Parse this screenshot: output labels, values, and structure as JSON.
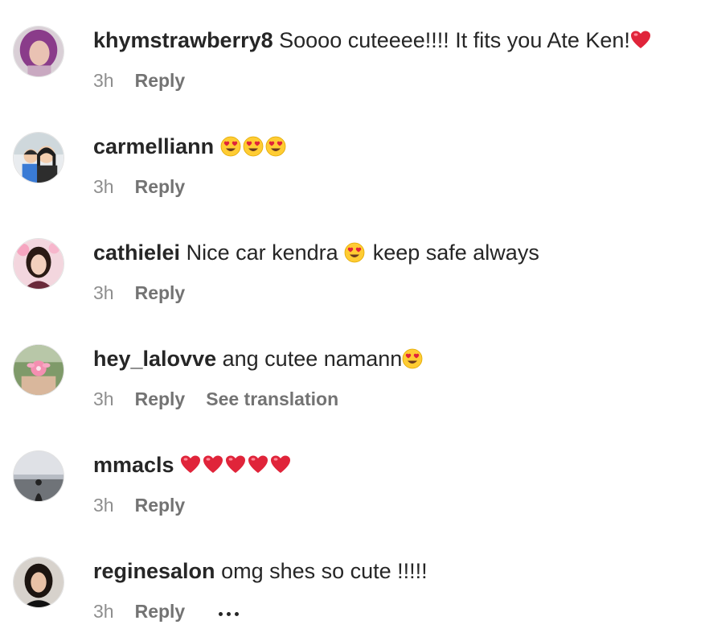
{
  "comments": [
    {
      "username": "khymstrawberry8",
      "text": "Soooo cuteeee!!!! It fits you Ate Ken!",
      "emoji": [
        "heart"
      ],
      "time": "3h",
      "reply": "Reply"
    },
    {
      "username": "carmelliann",
      "text": "",
      "emoji": [
        "heart-eyes",
        "heart-eyes",
        "heart-eyes"
      ],
      "time": "3h",
      "reply": "Reply"
    },
    {
      "username": "cathielei",
      "text_before": "Nice car kendra",
      "text_after": "keep safe always",
      "emoji": [
        "heart-eyes"
      ],
      "time": "3h",
      "reply": "Reply"
    },
    {
      "username": "hey_lalovve",
      "text": "ang cutee namann",
      "emoji": [
        "heart-eyes"
      ],
      "time": "3h",
      "reply": "Reply",
      "translate": "See translation"
    },
    {
      "username": "mmacls",
      "text": "",
      "emoji": [
        "heart",
        "heart",
        "heart",
        "heart",
        "heart"
      ],
      "time": "3h",
      "reply": "Reply"
    },
    {
      "username": "reginesalon",
      "text": "omg shes so cute !!!!!",
      "emoji": [],
      "time": "3h",
      "reply": "Reply",
      "more_icon": "more-options-icon"
    }
  ],
  "colors": {
    "text": "#262626",
    "secondary": "#8e8e8e",
    "heart": "#e0243a",
    "emoji_face": "#ffcc33"
  }
}
